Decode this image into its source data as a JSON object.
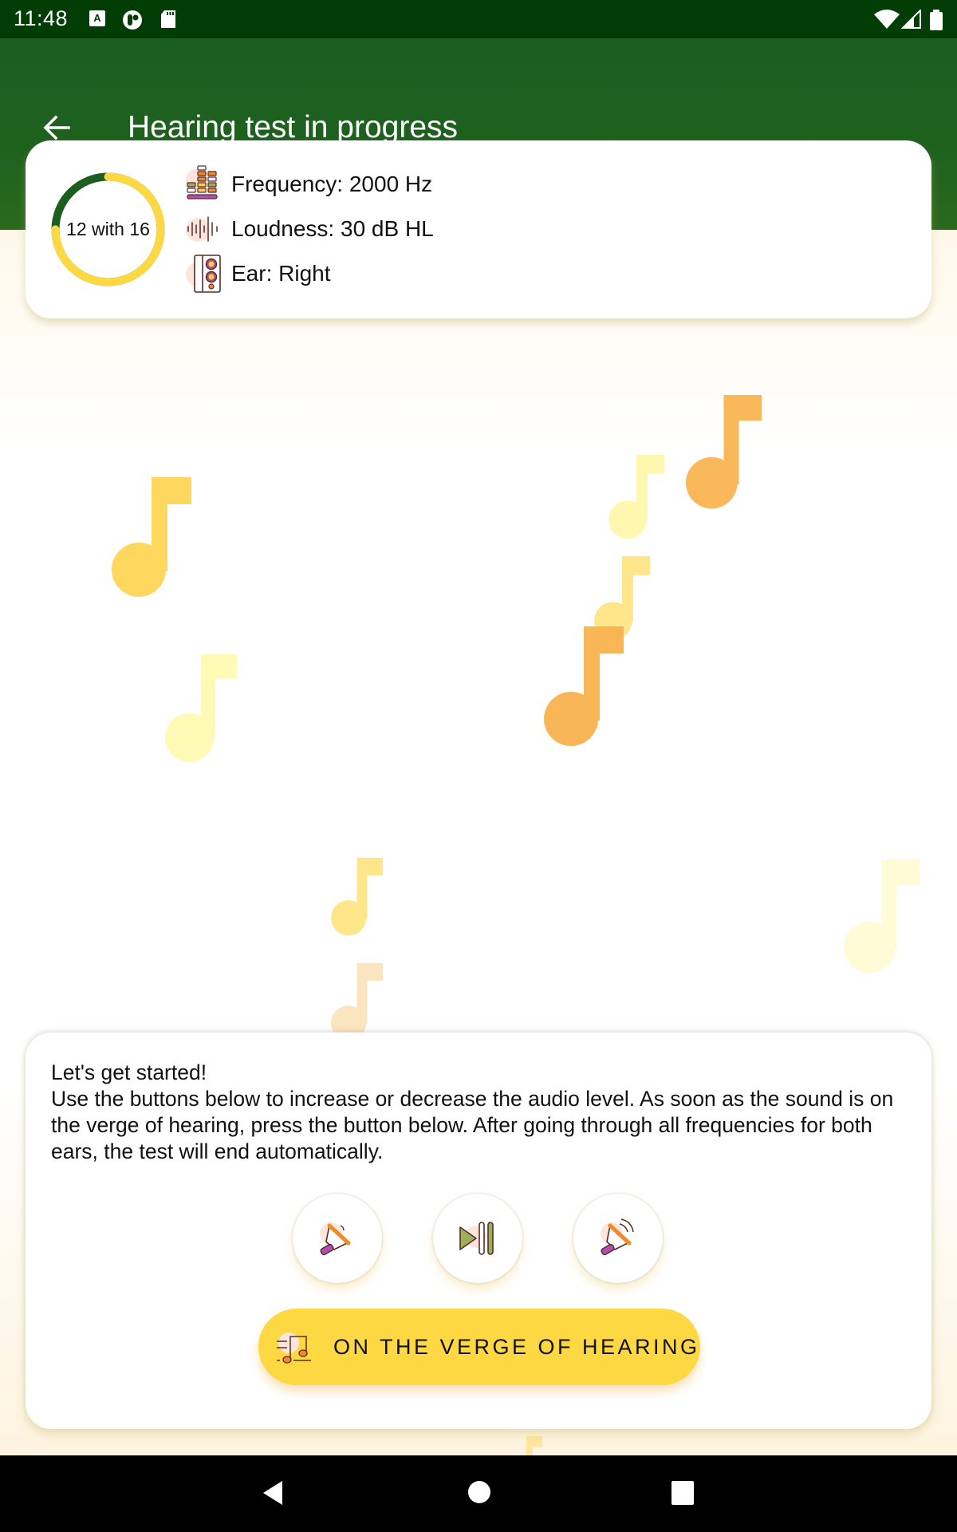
{
  "status_bar": {
    "time": "11:48",
    "icons": [
      "keyboard-a-icon",
      "app-notification-icon",
      "sd-card-icon",
      "wifi-icon",
      "cellular-signal-icon",
      "battery-icon"
    ]
  },
  "app_bar": {
    "back_icon": "arrow-left-icon",
    "title": "Hearing test in progress"
  },
  "colors": {
    "app_bar_green": "#1e611f",
    "status_bar_green": "#013d05",
    "progress_yellow": "#fdd843",
    "progress_green": "#1b5e20",
    "accent_yellow": "#fdd843",
    "note_orange": "#f9b95a"
  },
  "info_card": {
    "progress": {
      "label": "12 with 16",
      "current": 12,
      "total": 16,
      "fraction": 0.75
    },
    "rows": [
      {
        "icon": "equalizer-icon",
        "text": "Frequency: 2000 Hz"
      },
      {
        "icon": "sound-wave-icon",
        "text": "Loudness: 30 dB HL"
      },
      {
        "icon": "speaker-icon",
        "text": "Ear: Right"
      }
    ]
  },
  "background": {
    "decoration": "music-note-icon"
  },
  "bottom_panel": {
    "instructions": "Let's get started!\nUse the buttons below to increase or decrease the audio level. As soon as the sound is on the verge of hearing, press the button below. After going through all frequencies for both ears, the test will end automatically.",
    "buttons": [
      {
        "name": "volume-down-button",
        "icon": "volume-down-icon"
      },
      {
        "name": "play-pause-button",
        "icon": "play-pause-icon"
      },
      {
        "name": "volume-up-button",
        "icon": "volume-up-icon"
      }
    ],
    "verge_button": {
      "icon": "music-sheet-icon",
      "label": "ON THE VERGE OF HEARING"
    }
  },
  "nav_bar": {
    "items": [
      "back-nav-icon",
      "home-nav-icon",
      "recents-nav-icon"
    ]
  }
}
